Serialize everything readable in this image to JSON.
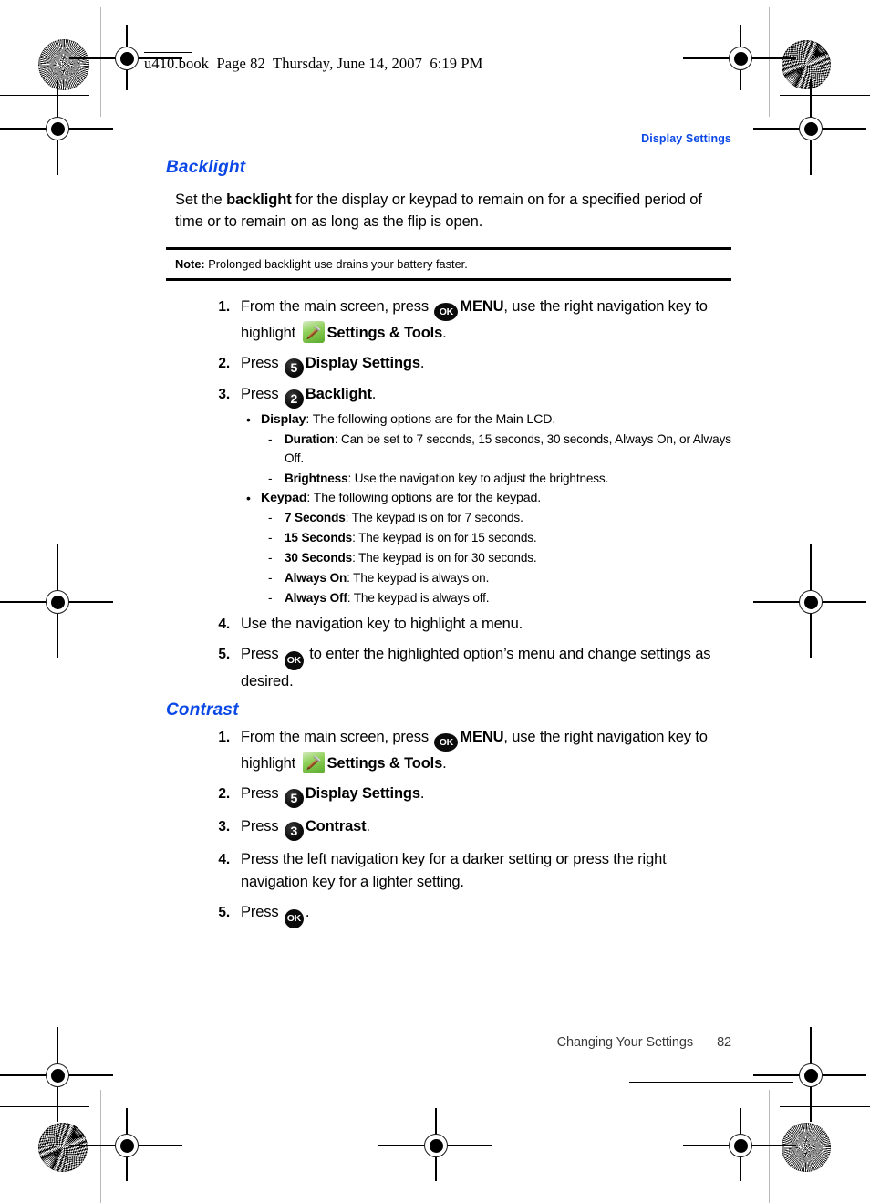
{
  "book_tag": "u410.book  Page 82  Thursday, June 14, 2007  6:19 PM",
  "running_head": "Display Settings",
  "accent_color": "#0b48e6",
  "sections": [
    {
      "heading": "Backlight",
      "lead": {
        "before": "Set the ",
        "bold": "backlight",
        "after": " for the display or keypad to remain on for a specified period of time or to remain on as long as the flip is open."
      },
      "note": {
        "label": "Note:",
        "text": " Prolonged backlight use drains your battery faster."
      },
      "steps": [
        {
          "num": "1.",
          "t1": "From the main screen, press ",
          "ok_icon": "ok-key-icon",
          "t2": "MENU",
          "t3": ", use the right navigation key to highlight ",
          "tools_icon": "settings-tools-icon",
          "t4": "Settings & Tools",
          "t5": "."
        },
        {
          "num": "2.",
          "t1": "Press ",
          "key": "5",
          "t2": "Display Settings",
          "t3": "."
        },
        {
          "num": "3.",
          "t1": "Press ",
          "key": "2",
          "t2": "Backlight",
          "t3": ".",
          "bullets": [
            {
              "term": "Display",
              "desc": ": The following options are for the Main LCD.",
              "subs": [
                {
                  "term": "Duration",
                  "desc": ": Can be set to 7 seconds, 15 seconds, 30 seconds, Always On, or Always Off."
                },
                {
                  "term": "Brightness",
                  "desc": ": Use the navigation key to adjust the brightness."
                }
              ]
            },
            {
              "term": "Keypad",
              "desc": ": The following options are for the keypad.",
              "subs": [
                {
                  "term": "7 Seconds",
                  "desc": ": The keypad is on for 7 seconds."
                },
                {
                  "term": "15 Seconds",
                  "desc": ": The keypad is on for 15 seconds."
                },
                {
                  "term": "30 Seconds",
                  "desc": ": The keypad is on for 30 seconds."
                },
                {
                  "term": "Always On",
                  "desc": ": The keypad is always on."
                },
                {
                  "term": "Always Off",
                  "desc": ": The keypad is always off."
                }
              ]
            }
          ]
        },
        {
          "num": "4.",
          "t1": "Use the navigation key to highlight a menu."
        },
        {
          "num": "5.",
          "t1": "Press ",
          "ok_icon": "ok-key-icon",
          "t2": " to enter the highlighted option’s menu and change settings as desired."
        }
      ]
    },
    {
      "heading": "Contrast",
      "steps": [
        {
          "num": "1.",
          "t1": "From the main screen, press ",
          "ok_icon": "ok-key-icon",
          "t2": "MENU",
          "t3": ", use the right navigation key to highlight ",
          "tools_icon": "settings-tools-icon",
          "t4": "Settings & Tools",
          "t5": "."
        },
        {
          "num": "2.",
          "t1": "Press ",
          "key": "5",
          "t2": "Display Settings",
          "t3": "."
        },
        {
          "num": "3.",
          "t1": "Press ",
          "key": "3",
          "t2": "Contrast",
          "t3": "."
        },
        {
          "num": "4.",
          "t1": "Press the left navigation key for a darker setting or press the right navigation key for a lighter setting."
        },
        {
          "num": "5.",
          "t1": "Press ",
          "ok_icon": "ok-key-icon",
          "t2": "."
        }
      ]
    }
  ],
  "ok_key_label": "OK",
  "footer": {
    "chapter": "Changing Your Settings",
    "page_number": "82"
  }
}
